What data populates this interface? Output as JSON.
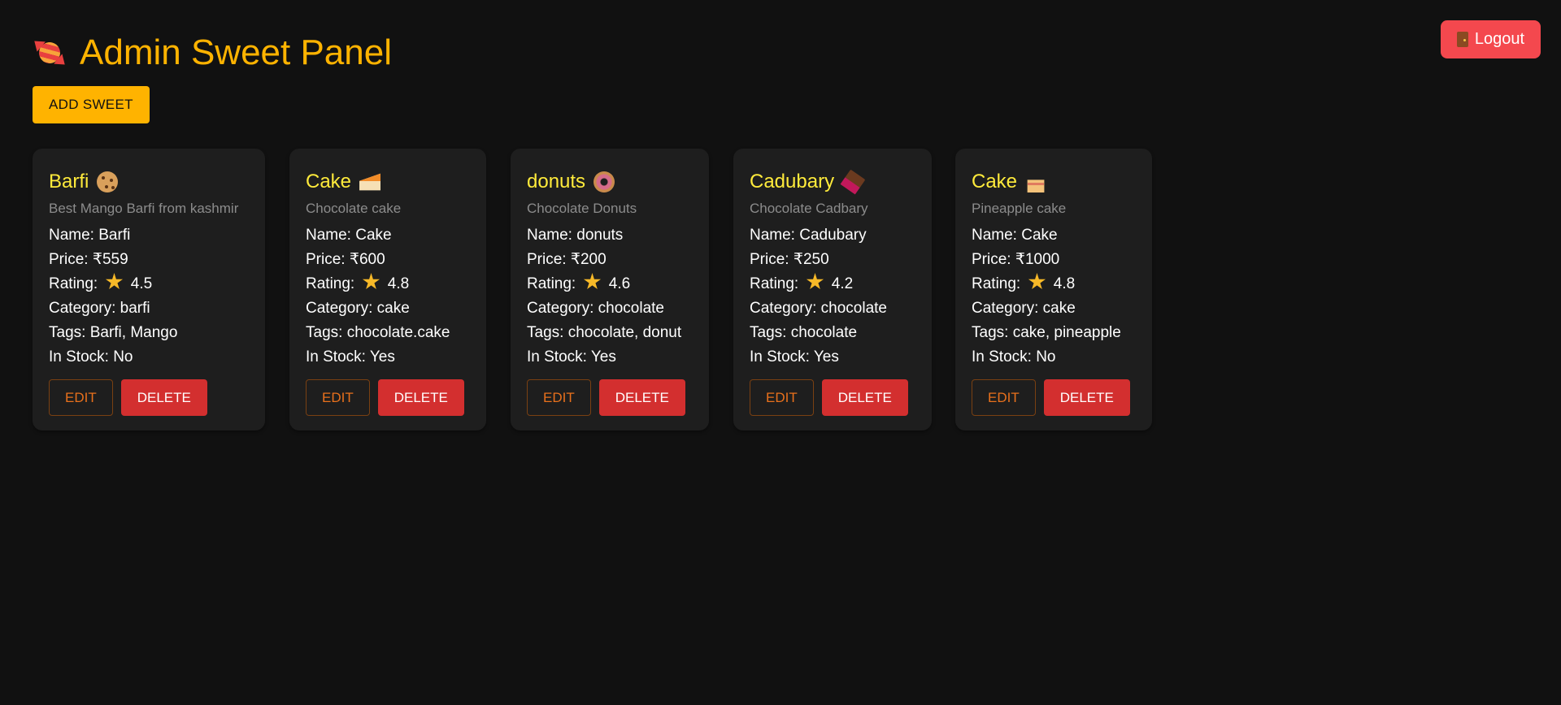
{
  "header": {
    "title": "Admin Sweet Panel",
    "logo_icon": "candy-icon",
    "title_color": "#ffb300"
  },
  "logout": {
    "label": "Logout",
    "icon": "door-icon",
    "color": "#f4484e"
  },
  "add_sweet": {
    "label": "ADD SWEET",
    "color": "#ffb300"
  },
  "field_labels": {
    "name": "Name:",
    "price": "Price:",
    "rating": "Rating:",
    "category": "Category:",
    "tags": "Tags:",
    "in_stock": "In Stock:"
  },
  "buttons": {
    "edit": "EDIT",
    "delete": "DELETE"
  },
  "sweets": [
    {
      "title": "Barfi",
      "icon": "cookie-icon",
      "description": "Best Mango Barfi from kashmir",
      "name": "Barfi",
      "price": "₹559",
      "rating": "4.5",
      "category": "barfi",
      "tags": "Barfi, Mango",
      "in_stock": "No"
    },
    {
      "title": "Cake",
      "icon": "cake-slice-icon",
      "description": "Chocolate cake",
      "name": "Cake",
      "price": "₹600",
      "rating": "4.8",
      "category": "cake",
      "tags": "chocolate.cake",
      "in_stock": "Yes"
    },
    {
      "title": "donuts",
      "icon": "donut-icon",
      "description": "Chocolate Donuts",
      "name": "donuts",
      "price": "₹200",
      "rating": "4.6",
      "category": "chocolate",
      "tags": "chocolate, donut",
      "in_stock": "Yes"
    },
    {
      "title": "Cadubary",
      "icon": "chocolate-icon",
      "description": "Chocolate Cadbary",
      "name": "Cadubary",
      "price": "₹250",
      "rating": "4.2",
      "category": "chocolate",
      "tags": "chocolate",
      "in_stock": "Yes"
    },
    {
      "title": "Cake",
      "icon": "birthday-cake-icon",
      "description": "Pineapple cake",
      "name": "Cake",
      "price": "₹1000",
      "rating": "4.8",
      "category": "cake",
      "tags": "cake, pineapple",
      "in_stock": "No"
    }
  ]
}
